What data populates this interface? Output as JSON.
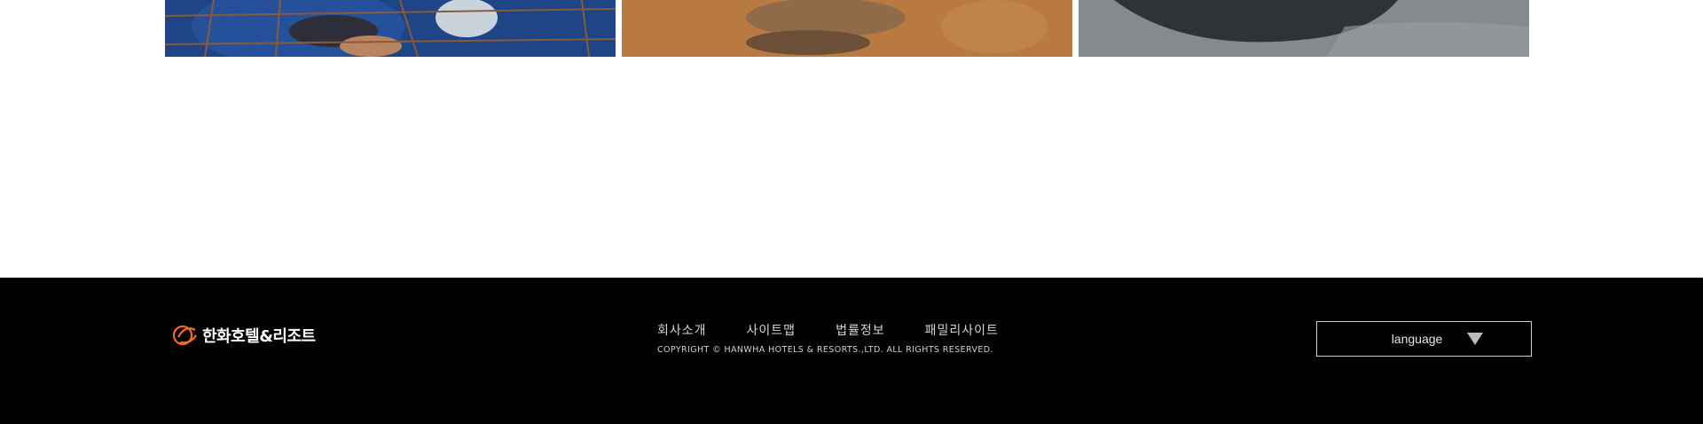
{
  "gallery": {
    "photos": [
      {
        "subject": "diver-in-shark-cage"
      },
      {
        "subject": "sea-turtle-on-sand"
      },
      {
        "subject": "stingray-in-water"
      }
    ]
  },
  "footer": {
    "logo_text": "한화호텔&리조트",
    "links": [
      "회사소개",
      "사이트맵",
      "법률정보",
      "패밀리사이트"
    ],
    "copyright": "COPYRIGHT © HANWHA HOTELS & RESORTS.,LTD. ALL RIGHTS RESERVED.",
    "language_label": "language",
    "colors": {
      "background": "#000000",
      "logo_accent": "#f26b21"
    }
  }
}
